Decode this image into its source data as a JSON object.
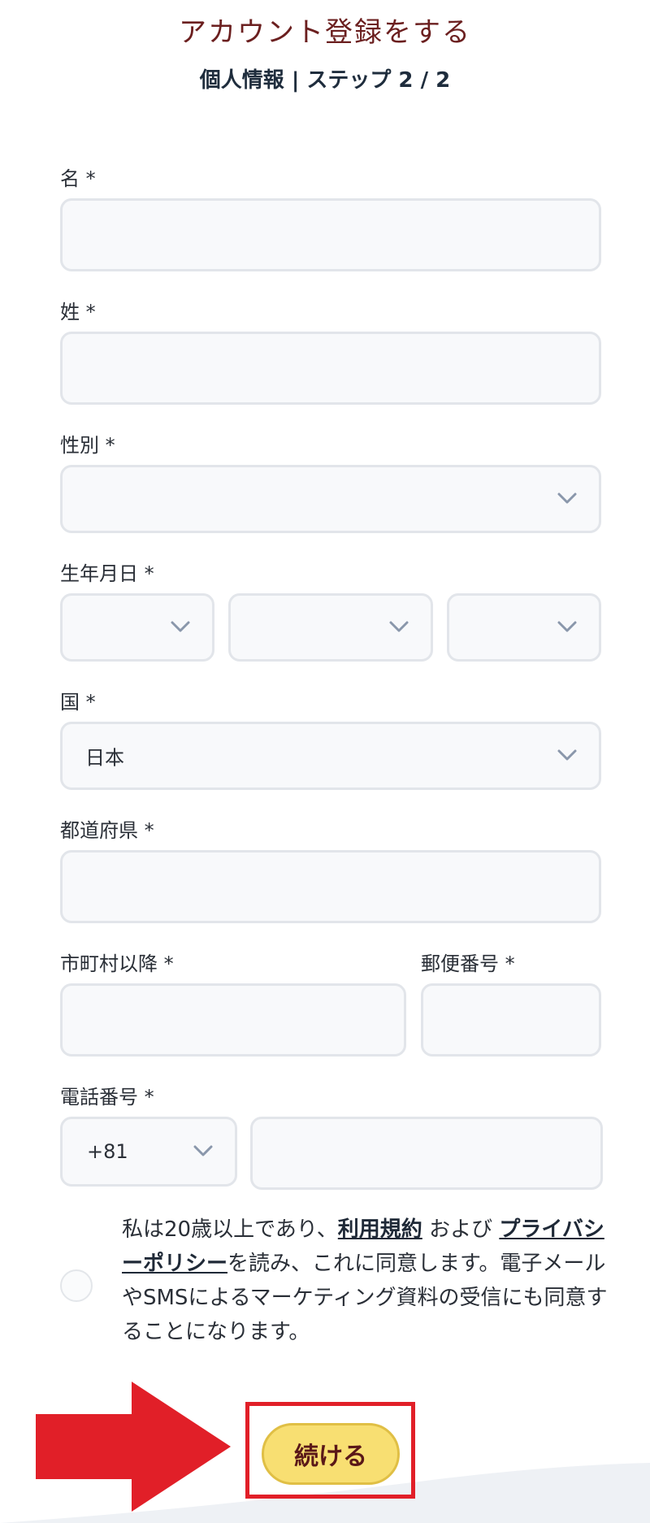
{
  "header": {
    "title": "アカウント登録をする",
    "subtitle": "個人情報 | ステップ 2 / 2"
  },
  "form": {
    "first_name": {
      "label": "名 *",
      "value": ""
    },
    "last_name": {
      "label": "姓 *",
      "value": ""
    },
    "gender": {
      "label": "性別 *",
      "value": ""
    },
    "birthdate": {
      "label": "生年月日 *",
      "day": "",
      "month": "",
      "year": ""
    },
    "country": {
      "label": "国 *",
      "value": "日本"
    },
    "prefecture": {
      "label": "都道府県 *",
      "value": ""
    },
    "city": {
      "label": "市町村以降 *",
      "value": ""
    },
    "postal_code": {
      "label": "郵便番号 *",
      "value": ""
    },
    "phone": {
      "label": "電話番号 *",
      "country_code": "+81",
      "number": ""
    }
  },
  "consent": {
    "text_before": "私は20歳以上であり、",
    "terms_link": "利用規約",
    "text_middle": " および ",
    "privacy_link": "プライバシーポリシー",
    "text_after": "を読み、これに同意します。電子メールやSMSによるマーケティング資料の受信にも同意することになります。",
    "checked": false
  },
  "continue_button": {
    "label": "続ける"
  },
  "colors": {
    "title": "#6b1f1f",
    "button_bg": "#f8df72",
    "highlight": "#e11f28",
    "field_bg": "#f8f9fb"
  },
  "icons": {
    "select_caret": "chevron-down-icon",
    "annotation": "red-arrow-icon"
  }
}
